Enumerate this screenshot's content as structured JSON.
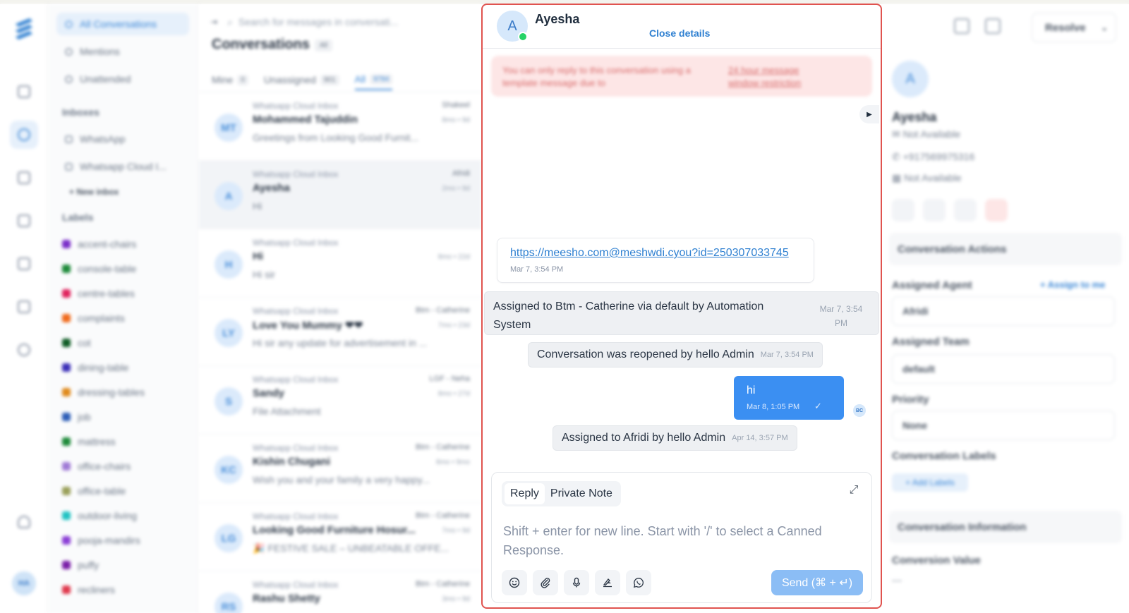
{
  "background": {
    "nav": {
      "items": [
        "All Conversations",
        "Mentions",
        "Unattended"
      ],
      "inboxes_heading": "Inboxes",
      "inboxes": [
        "WhatsApp",
        "Whatsapp Cloud I..."
      ],
      "new_inbox": "+ New inbox",
      "labels_heading": "Labels",
      "labels": [
        {
          "name": "accent-chairs",
          "color": "#7b2fc9"
        },
        {
          "name": "console-table",
          "color": "#1e8a3a"
        },
        {
          "name": "centre-tables",
          "color": "#e0245e"
        },
        {
          "name": "complaints",
          "color": "#f06a1c"
        },
        {
          "name": "cot",
          "color": "#0f5c25"
        },
        {
          "name": "dining-table",
          "color": "#3b2fb8"
        },
        {
          "name": "dressing-tables",
          "color": "#e08a1c"
        },
        {
          "name": "job",
          "color": "#2f5fb8"
        },
        {
          "name": "mattress",
          "color": "#1e8a3a"
        },
        {
          "name": "office-chairs",
          "color": "#a07ad6"
        },
        {
          "name": "office-table",
          "color": "#9aa05a"
        },
        {
          "name": "outdoor-living",
          "color": "#22c3c3"
        },
        {
          "name": "pooja-mandirs",
          "color": "#8b3fd6"
        },
        {
          "name": "puffy",
          "color": "#7a1fa8"
        },
        {
          "name": "recliners",
          "color": "#e03a4e"
        }
      ]
    },
    "list": {
      "search_placeholder": "Search for messages in conversati...",
      "title": "Conversations",
      "title_badge": "All",
      "tabs": [
        {
          "label": "Mine",
          "count": "0"
        },
        {
          "label": "Unassigned",
          "count": "901"
        },
        {
          "label": "All",
          "count": "9784"
        }
      ],
      "items": [
        {
          "initials": "MT",
          "inbox": "Whatsapp Cloud Inbox",
          "agent": "Shakeel",
          "name": "Mohammed Tajuddin",
          "ago": "8mo • 9d",
          "msg": "Greetings from Looking Good Furnit..."
        },
        {
          "initials": "A",
          "inbox": "Whatsapp Cloud Inbox",
          "agent": "Afridi",
          "name": "Ayesha",
          "ago": "2mo • 9d",
          "msg": "Hi"
        },
        {
          "initials": "H",
          "inbox": "Whatsapp Cloud Inbox",
          "agent": "",
          "name": "Hi",
          "ago": "8mo • 22d",
          "msg": "Hi sir"
        },
        {
          "initials": "LY",
          "inbox": "Whatsapp Cloud Inbox",
          "agent": "Btm - Catherine",
          "name": "Love You Mummy ❤❤",
          "ago": "7mo • 23d",
          "msg": "Hi sir any update for advertisement in ..."
        },
        {
          "initials": "S",
          "inbox": "Whatsapp Cloud Inbox",
          "agent": "LGF - Neha",
          "name": "Sandy",
          "ago": "8mo • 27d",
          "msg": "File Attachment"
        },
        {
          "initials": "KC",
          "inbox": "Whatsapp Cloud Inbox",
          "agent": "Btm - Catherine",
          "name": "Kishin Chugani",
          "ago": "8mo • 9mo",
          "msg": "Wish you and your family a very happy..."
        },
        {
          "initials": "LG",
          "inbox": "Whatsapp Cloud Inbox",
          "agent": "Btm - Catherine",
          "name": "Looking Good Furniture Hosur...",
          "ago": "7mo • 9d",
          "msg": "🎉 FESTIVE SALE – UNBEATABLE OFFE..."
        },
        {
          "initials": "RS",
          "inbox": "Whatsapp Cloud Inbox",
          "agent": "Btm - Catherine",
          "name": "Rashu Shetty",
          "ago": "3mo • 9d",
          "msg": ""
        }
      ]
    },
    "contact": {
      "resolve_label": "Resolve",
      "initial": "A",
      "name": "Ayesha",
      "email": "Not Available",
      "phone": "+917569975316",
      "company": "Not Available",
      "actions_heading": "Conversation Actions",
      "assigned_agent_label": "Assigned Agent",
      "assign_to_me": "+ Assign to me",
      "assigned_agent": "Afridi",
      "assigned_team_label": "Assigned Team",
      "assigned_team": "default",
      "priority_label": "Priority",
      "priority": "None",
      "labels_label": "Conversation Labels",
      "add_labels": "+ Add Labels",
      "info_heading": "Conversation Information",
      "conversion_label": "Conversion Value",
      "conversion_value": "---"
    }
  },
  "chat": {
    "contact_initial": "A",
    "contact_name": "Ayesha",
    "close_details": "Close details",
    "warning_text": "You can only reply to this conversation using a template message due to",
    "warning_link": "24 hour message window restriction",
    "link_message": {
      "url": "https://meesho.com@meshwdi.cyou?id=250307033745",
      "time": "Mar 7, 3:54 PM"
    },
    "activities": [
      {
        "text": "Assigned to Btm - Catherine via default by Automation System",
        "time": "Mar 7, 3:54 PM"
      },
      {
        "text": "Conversation was reopened by hello Admin",
        "time": "Mar 7, 3:54 PM"
      },
      {
        "text": "Assigned to Afridi by hello Admin",
        "time": "Apr 14, 3:57 PM"
      }
    ],
    "outgoing": {
      "text": "hi",
      "time": "Mar 8, 1:05 PM",
      "sender_initials": "BC"
    },
    "composer": {
      "mode_reply": "Reply",
      "mode_private": "Private Note",
      "placeholder": "Shift + enter for new line. Start with '/' to select a Canned Response.",
      "send_label": "Send (⌘ + ↵)"
    },
    "colors": {
      "accent": "#3b8ff2",
      "border_highlight": "#e0534f",
      "whatsapp": "#25d366"
    }
  }
}
